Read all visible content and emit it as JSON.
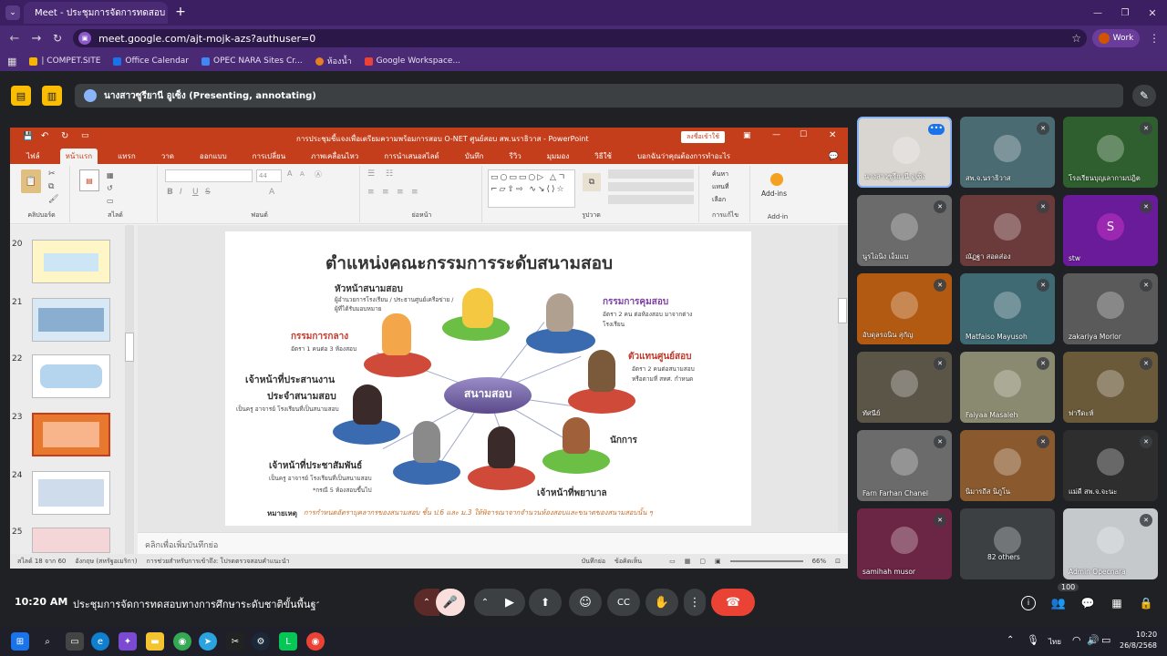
{
  "browser": {
    "tab_title": "Meet - ประชุมการจัดการทดสอบ",
    "url": "meet.google.com/ajt-mojk-azs?authuser=0",
    "profile_label": "Work",
    "bookmarks": [
      "| COMPET.SITE",
      "Office Calendar",
      "OPEC NARA Sites Cr...",
      "ห้องน้ำ",
      "Google Workspace..."
    ]
  },
  "meet": {
    "presenter_label": "นางสาวซูรียานี อูเซ็ง (Presenting, annotating)",
    "time": "10:20 AM",
    "meeting_title": "ประชุมการจัดการทดสอบทางการศึกษาระดับชาติขั้นพื้นฐาน (...",
    "participants_badge": "100",
    "participants": [
      {
        "name": "นางสาวซูรียานี อูเซ็ง",
        "bg": "#d9d5d0"
      },
      {
        "name": "สพ.จ.นราธิวาส",
        "bg": "#4b6b73"
      },
      {
        "name": "โรงเรียนบุญเลากามปฎิต",
        "bg": "#2f5f2e"
      },
      {
        "name": "นูรไอนิง เอ็มแบ",
        "bg": "#6b6b6b"
      },
      {
        "name": "ณัฏฐา สอดส่อง",
        "bg": "#6b3a3a"
      },
      {
        "name": "stw",
        "bg": "#6a1b9a",
        "letter": "S"
      },
      {
        "name": "อับดุลรอนิน สุกัญ",
        "bg": "#b35a12"
      },
      {
        "name": "Matfaiso Mayusoh",
        "bg": "#3f6a73"
      },
      {
        "name": "zakariya Morlor",
        "bg": "#5a5a5a"
      },
      {
        "name": "ทัศนีย์",
        "bg": "#5b5548"
      },
      {
        "name": "Faiyaa Masaleh",
        "bg": "#8a8a70"
      },
      {
        "name": "ฟารีดะห์",
        "bg": "#6b5a3a"
      },
      {
        "name": "Farn Farhan Chanel",
        "bg": "#6b6b6b"
      },
      {
        "name": "นิมารถีส นิภูโน",
        "bg": "#8a5a2e"
      },
      {
        "name": "แม่ดี สพ.จ.จะนะ",
        "bg": "#2e2e2e"
      },
      {
        "name": "samihah musor",
        "bg": "#6b2545"
      },
      {
        "name": "82 others",
        "bg": "#3c4043"
      },
      {
        "name": "Admin Opecnara",
        "bg": "#c5c9cc"
      }
    ]
  },
  "ppt": {
    "window_title": "การประชุมชี้แจงเพื่อเตรียมความพร้อมการสอบ O-NET ศูนย์สอบ สพ.นราธิวาส - PowerPoint",
    "signin": "ลงชื่อเข้าใช้",
    "tabs": [
      "ไฟล์",
      "หน้าแรก",
      "แทรก",
      "วาด",
      "ออกแบบ",
      "การเปลี่ยน",
      "ภาพเคลื่อนไหว",
      "การนำเสนอสไลด์",
      "บันทึก",
      "รีวิว",
      "มุมมอง",
      "วิธีใช้",
      "บอกฉันว่าคุณต้องการทำอะไร"
    ],
    "groups": [
      "คลิปบอร์ด",
      "สไลด์",
      "ฟอนต์",
      "ย่อหน้า",
      "รูปวาด",
      "การแก้ไข",
      "Add-in"
    ],
    "addins": "Add-ins",
    "editing": [
      "ค้นหา",
      "แทนที่",
      "เลือก"
    ],
    "slide_numbers": [
      "20",
      "21",
      "22",
      "23",
      "24",
      "25"
    ],
    "notes_placeholder": "คลิกเพื่อเพิ่มบันทึกย่อ",
    "status_left": "สไลด์ 18 จาก 60",
    "status_lang": "อังกฤษ (สหรัฐอเมริกา)",
    "status_access": "การช่วยสำหรับการเข้าถึง: โปรดตรวจสอบคำแนะนำ",
    "status_notes": "บันทึกย่อ",
    "status_comments": "ข้อคิดเห็น",
    "zoom": "66%",
    "font_size": "44"
  },
  "slide": {
    "title": "ตำแหน่งคณะกรรมการระดับสนามสอบ",
    "center": "สนามสอบ",
    "roles": [
      {
        "title": "หัวหน้าสนามสอบ",
        "desc1": "ผู้อำนวยการโรงเรียน / ประธานศูนย์เครือข่าย /",
        "desc2": "ผู้ที่ได้รับมอบหมาย"
      },
      {
        "title": "กรรมการกลาง",
        "desc1": "อัตรา 1 คนต่อ 3 ห้องสอบ",
        "desc2": ""
      },
      {
        "title": "กรรมการคุมสอบ",
        "desc1": "อัตรา 2 คน ต่อห้องสอบ  มาจากต่าง",
        "desc2": "โรงเรียน"
      },
      {
        "title": "ตัวแทนศูนย์สอบ",
        "desc1": "อัตรา 2 คนต่อสนามสอบ",
        "desc2": "หรือตามที่ สทศ. กำหนด"
      },
      {
        "title": "เจ้าหน้าที่ประสานงาน",
        "title2": "ประจำสนามสอบ",
        "desc1": "เป็นครู อาจารย์ โรงเรียนที่เป็นสนามสอบ",
        "desc2": ""
      },
      {
        "title": "นักการ",
        "desc1": "",
        "desc2": ""
      },
      {
        "title": "เจ้าหน้าที่ประชาสัมพันธ์",
        "desc1": "เป็นครู อาจารย์ โรงเรียนที่เป็นสนามสอบ",
        "desc2": "*กรณี 5 ห้องสอบขึ้นไป"
      },
      {
        "title": "เจ้าหน้าที่พยาบาล",
        "desc1": "",
        "desc2": ""
      }
    ],
    "note_label": "หมายเหตุ",
    "note_text": "การกำหนดอัตราบุคลากรของสนามสอบ ชั้น ป.6 และ ม.3 ให้พิจารณาจากจำนวนห้องสอบและขนาดของสนามสอบนั้น ๆ"
  },
  "taskbar": {
    "time": "10:20",
    "date": "26/8/2568",
    "lang": "ไทย"
  },
  "colors": {
    "accent": "#c43e1c",
    "meet_red": "#ea4335",
    "slide_title": "#333333",
    "role_title": "#c0392b",
    "role_purple": "#7b3fa0"
  }
}
